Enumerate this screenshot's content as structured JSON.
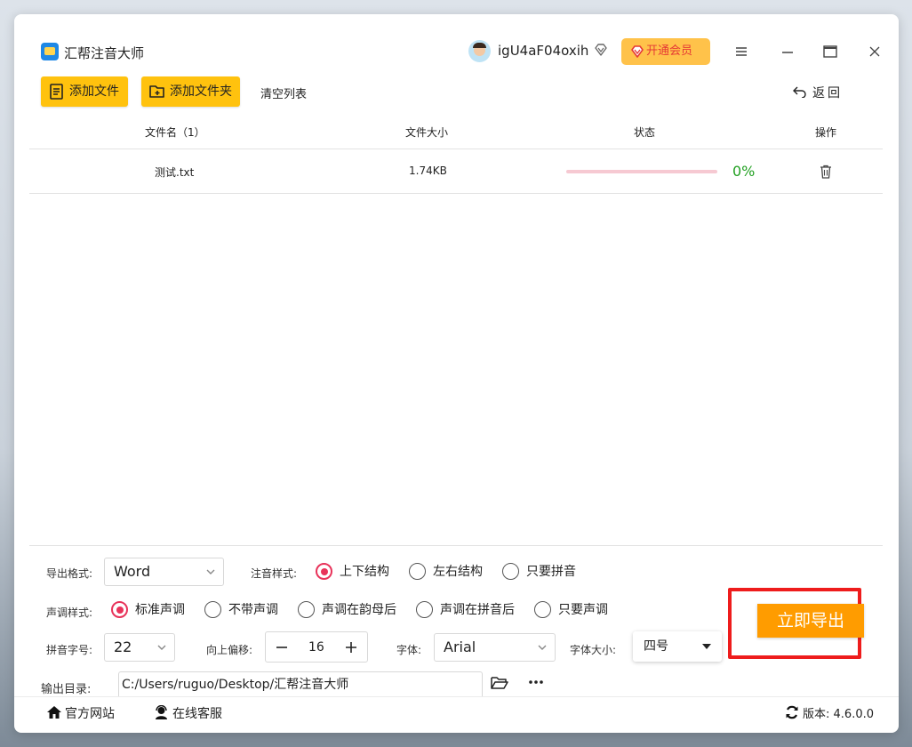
{
  "app": {
    "title": "汇帮注音大师",
    "username": "igU4aF04oxih",
    "vip_label": "开通会员"
  },
  "toolbar": {
    "add_file": "添加文件",
    "add_folder": "添加文件夹",
    "clear_list": "清空列表",
    "back": "返回"
  },
  "table": {
    "headers": {
      "name": "文件名（1）",
      "size": "文件大小",
      "status": "状态",
      "operation": "操作"
    },
    "rows": [
      {
        "name": "测试.txt",
        "size": "1.74KB",
        "progress_pct": 0,
        "progress_text": "0%"
      }
    ]
  },
  "settings": {
    "export_format_label": "导出格式:",
    "export_format_value": "Word",
    "annotation_style_label": "注音样式:",
    "annotation_options": [
      {
        "label": "上下结构",
        "selected": true
      },
      {
        "label": "左右结构",
        "selected": false
      },
      {
        "label": "只要拼音",
        "selected": false
      }
    ],
    "tone_style_label": "声调样式:",
    "tone_options": [
      {
        "label": "标准声调",
        "selected": true
      },
      {
        "label": "不带声调",
        "selected": false
      },
      {
        "label": "声调在韵母后",
        "selected": false
      },
      {
        "label": "声调在拼音后",
        "selected": false
      },
      {
        "label": "只要声调",
        "selected": false
      }
    ],
    "pinyin_size_label": "拼音字号:",
    "pinyin_size_value": "22",
    "offset_label": "向上偏移:",
    "offset_value": "16",
    "font_label": "字体:",
    "font_value": "Arial",
    "font_size_label": "字体大小:",
    "font_size_value": "四号",
    "output_dir_label": "输出目录:",
    "output_dir_value": "C:/Users/ruguo/Desktop/汇帮注音大师",
    "export_button": "立即导出"
  },
  "footer": {
    "official_site": "官方网站",
    "online_service": "在线客服",
    "version_label": "版本:",
    "version_value": "4.6.0.0"
  },
  "colors": {
    "accent_yellow": "#ffc20e",
    "export_orange": "#ff9c00",
    "radio_pink": "#e8335a",
    "highlight_red": "#ee1c1c",
    "progress_green": "#22a022"
  }
}
